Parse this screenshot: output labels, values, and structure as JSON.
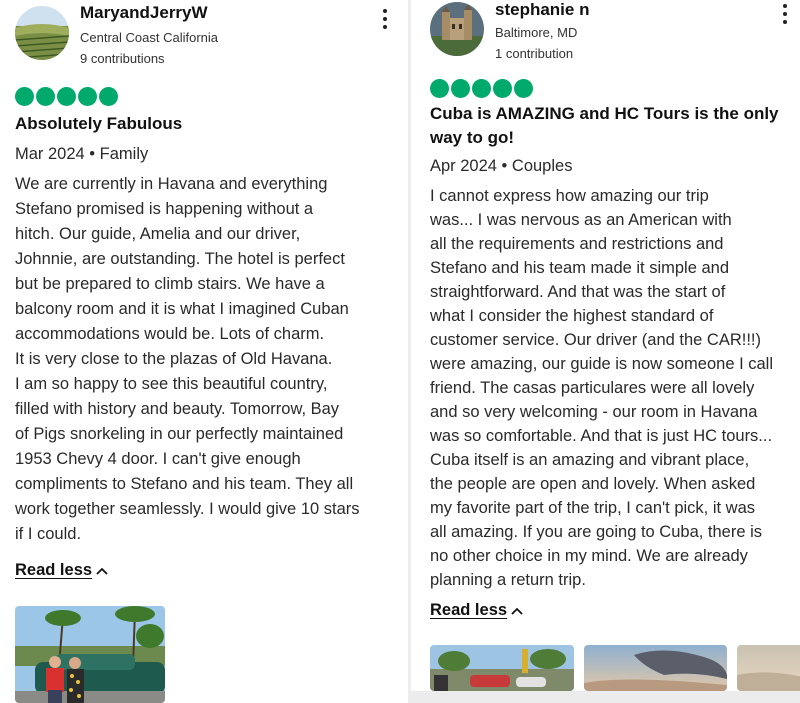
{
  "reviews": [
    {
      "user": {
        "name": "MaryandJerryW",
        "location": "Central Coast California",
        "contributions": "9 contributions"
      },
      "rating": 5,
      "title": "Absolutely Fabulous",
      "meta": "Mar 2024 • Family",
      "body_lines": [
        "We are currently in Havana and everything",
        "Stefano promised is happening without a",
        "hitch. Our guide, Amelia and our driver,",
        "Johnnie, are outstanding. The hotel is perfect",
        "but be prepared to climb stairs. We have a",
        "balcony room and it is what I imagined Cuban",
        "accommodations would be. Lots of charm.",
        "It is very close to the plazas of Old Havana.",
        "I am so happy to see this beautiful country,",
        "filled with history and beauty. Tomorrow, Bay",
        "of Pigs snorkeling in our perfectly maintained",
        "1953 Chevy 4 door. I can't give enough",
        "compliments to Stefano and his team. They all",
        "work together seamlessly. I would give 10 stars",
        "if I could."
      ],
      "read_less": "Read less"
    },
    {
      "user": {
        "name": "stephanie n",
        "location": "Baltimore, MD",
        "contributions": "1 contribution"
      },
      "rating": 5,
      "title_lines": [
        "Cuba is AMAZING and HC Tours is the only",
        "way to go!"
      ],
      "meta": "Apr 2024 • Couples",
      "body_lines": [
        "I cannot express how amazing our trip",
        "was... I was nervous as an American with",
        "all the requirements and restrictions and",
        "Stefano and his team made it simple and",
        "straightforward. And that was the start of",
        "what I consider the highest standard of",
        "customer service. Our driver (and the CAR!!!)",
        "were amazing, our guide is now someone I call",
        "friend. The casas particulares were all lovely",
        "and so very welcoming - our room in Havana",
        "was so comfortable. And that is just HC tours...",
        "Cuba itself is an amazing and vibrant place,",
        "the people are open and lovely. When asked",
        "my favorite part of the trip, I can't pick, it was",
        "all amazing. If you are going to Cuba, there is",
        "no other choice in my mind. We are already",
        "planning a return trip."
      ],
      "read_less": "Read less"
    }
  ],
  "icons": {
    "more": "more-vertical-icon",
    "chevron": "chevron-up-icon"
  },
  "colors": {
    "rating_bubble": "#00aa6c"
  }
}
